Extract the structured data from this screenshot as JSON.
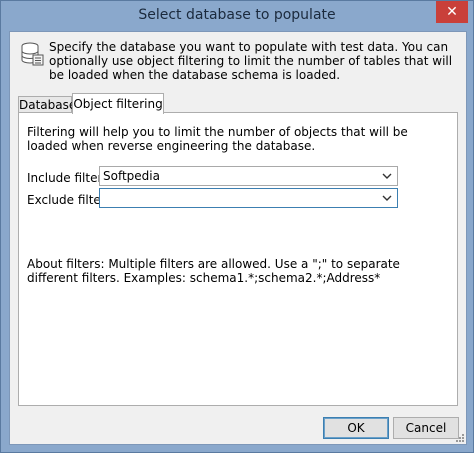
{
  "window": {
    "title": "Select database to populate",
    "close_label": "✕"
  },
  "intro": {
    "text": "Specify the database you want to populate with test data. You can optionally use object filtering to limit the number of tables that will be loaded when the database schema is loaded."
  },
  "tabs": [
    {
      "label": "Database",
      "active": false
    },
    {
      "label": "Object filtering",
      "active": true
    }
  ],
  "filtering": {
    "description": "Filtering will help you to limit the number of objects that will be loaded when reverse engineering the database.",
    "include_label": "Include filter:",
    "include_value": "Softpedia",
    "exclude_label": "Exclude filter:",
    "exclude_value": "",
    "about": "About filters: Multiple filters are allowed. Use a \";\" to separate different filters. Examples: schema1.*;schema2.*;Address*"
  },
  "buttons": {
    "ok_label": "OK",
    "cancel_label": "Cancel"
  },
  "colors": {
    "title_bar": "#8aa8cc",
    "close_button": "#c9403a",
    "focus_border": "#3c7fb1"
  }
}
